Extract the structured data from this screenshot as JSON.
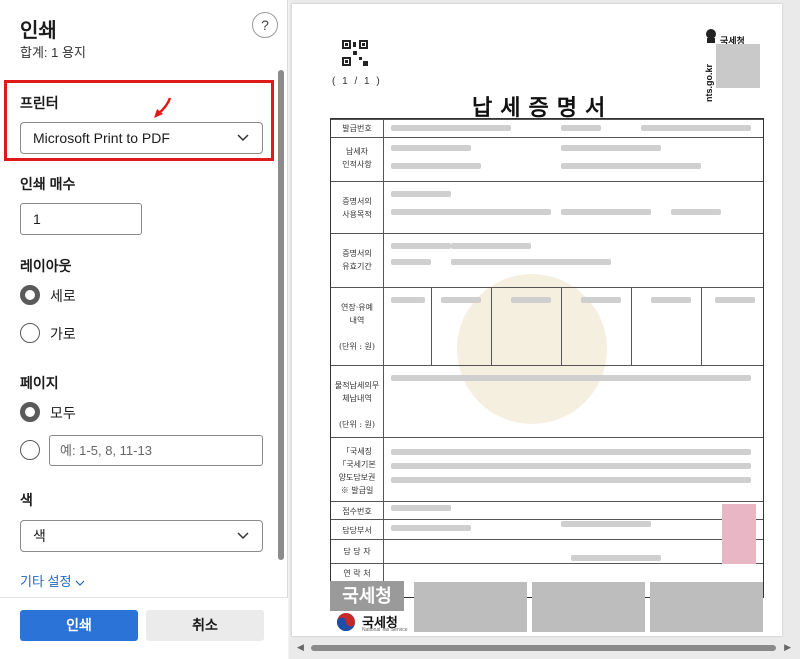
{
  "panel": {
    "title": "인쇄",
    "subtitle": "합계: 1 용지",
    "help_icon": "?",
    "printer": {
      "label": "프린터",
      "value": "Microsoft Print to PDF"
    },
    "copies": {
      "label": "인쇄 매수",
      "value": "1"
    },
    "layout": {
      "label": "레이아웃",
      "options": [
        "세로",
        "가로"
      ],
      "selected": "세로"
    },
    "pages": {
      "label": "페이지",
      "all": "모두",
      "range_placeholder": "예: 1-5, 8, 11-13",
      "selected": "모두"
    },
    "color": {
      "label": "색",
      "value": "색"
    },
    "more_settings": "기타 설정",
    "print_button": "인쇄",
    "cancel_button": "취소"
  },
  "preview": {
    "page_indicator": "( 1 / 1 )",
    "document_title": "납세증명서",
    "agency_label": "국세청",
    "site_url": "nts.go.kr",
    "row_labels": [
      "발급번호",
      "납세자\n인적사항",
      "증명서의\n사용목적",
      "증명서의\n유효기간",
      "연장·유예\n내역\n\n(단위 : 원)",
      "물적납세의무\n체납내역\n\n(단위 : 원)",
      "「국세징\n「국세기본\n양도담보권\n※ 발급일",
      "접수번호",
      "담당부서",
      "담 당 자",
      "연 락 처"
    ],
    "logo_watermark": "국세청",
    "logo_name": "국세청",
    "logo_sub": "National Tax Service"
  },
  "colors": {
    "accent": "#2b73d6",
    "annotation": "#e0191b"
  }
}
